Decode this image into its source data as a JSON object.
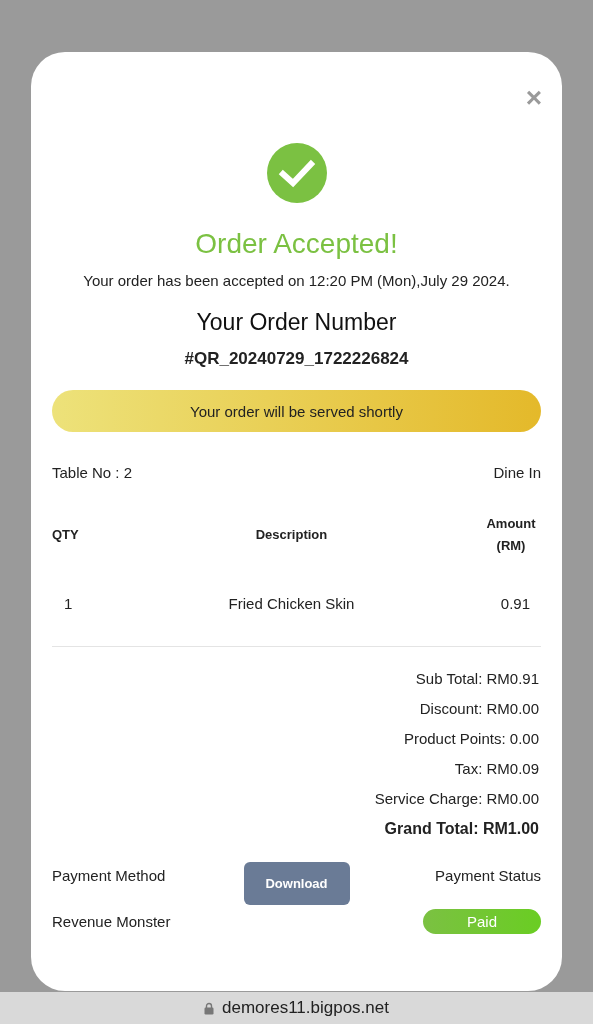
{
  "dialog": {
    "close": "×",
    "title": "Order Accepted!",
    "message": "Your order has been accepted on 12:20 PM (Mon),July 29 2024.",
    "order_number_label": "Your Order Number",
    "order_number": "#QR_20240729_1722226824"
  },
  "banner": "Your order will be served shortly",
  "table_no": "Table No : 2",
  "order_type": "Dine In",
  "table": {
    "columns": [
      "QTY",
      "Description",
      "Amount (RM)"
    ],
    "rows": [
      [
        "1",
        "Fried Chicken Skin",
        "0.91"
      ]
    ]
  },
  "summary": [
    {
      "text": "Sub Total: RM0.91",
      "kind": "line"
    },
    {
      "text": "Discount: RM0.00",
      "kind": "line"
    },
    {
      "text": "Product Points: 0.00",
      "kind": "line"
    },
    {
      "text": "Tax: RM0.09",
      "kind": "line"
    },
    {
      "text": "Service Charge: RM0.00",
      "kind": "line"
    },
    {
      "text": "Grand Total: RM1.00",
      "kind": "total"
    }
  ],
  "payment": {
    "method_label": "Payment Method",
    "method": "Revenue Monster",
    "download": "Download",
    "status_label": "Payment Status",
    "status": "Paid"
  },
  "address_bar": {
    "url": "demores11.bigpos.net"
  }
}
